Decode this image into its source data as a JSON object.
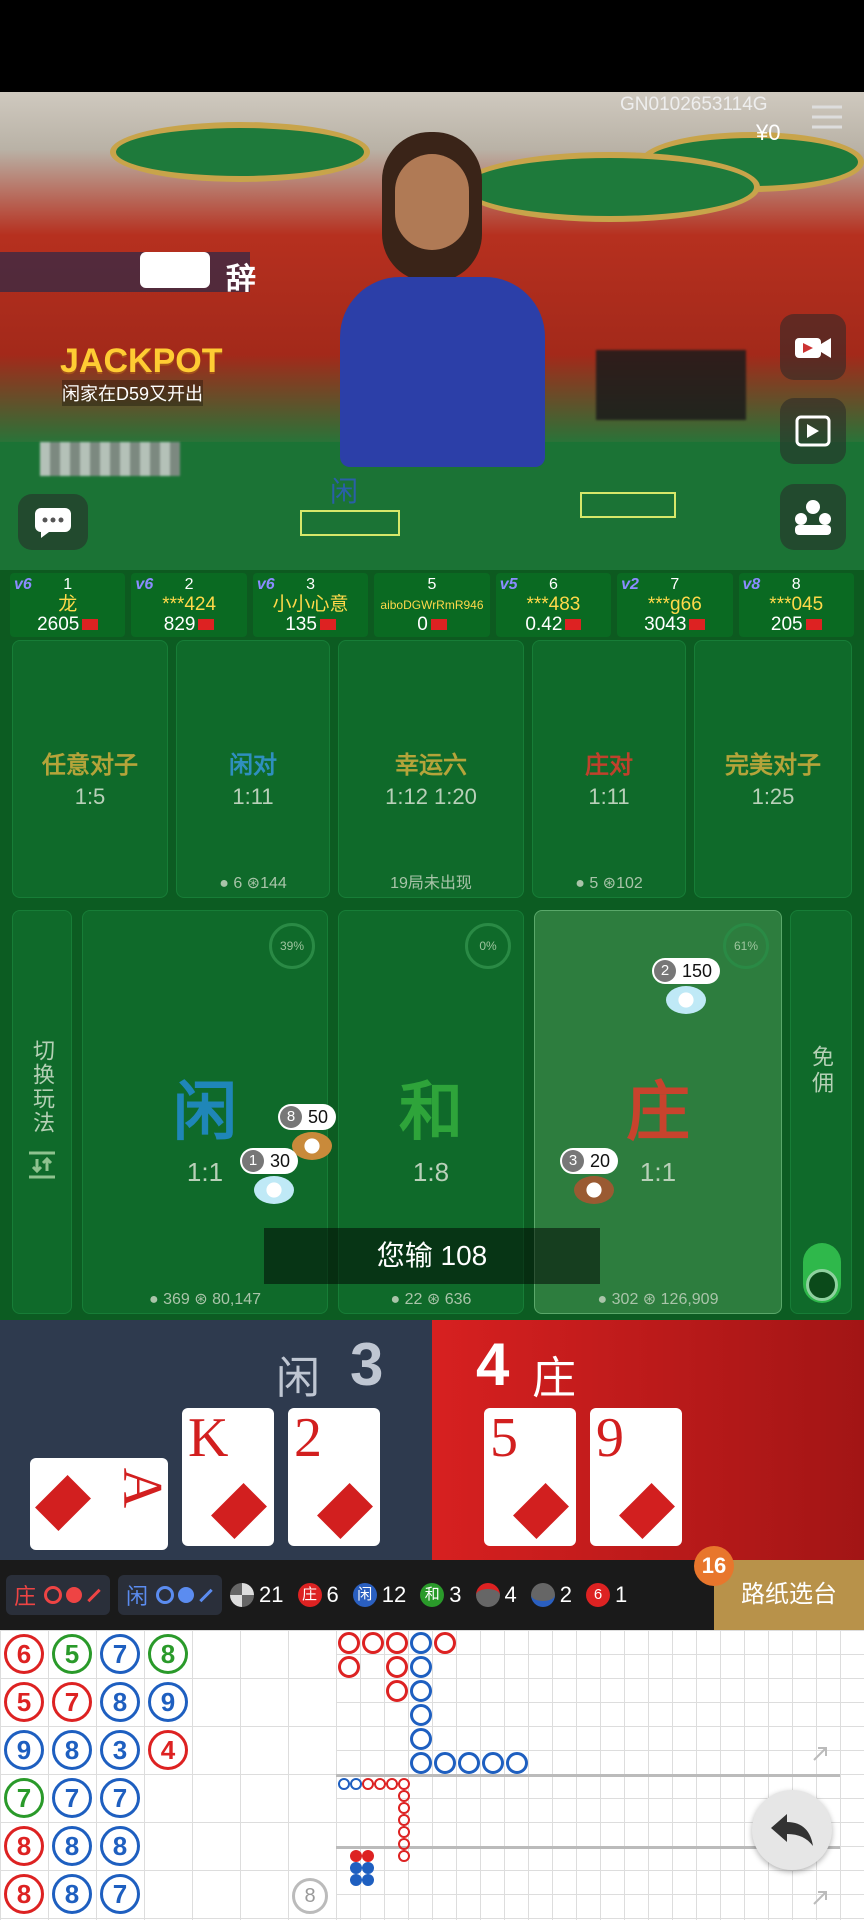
{
  "video": {
    "game_id": "GN0102653114G",
    "balance": "¥0",
    "jackpot_label": "JACKPOT",
    "jackpot_msg": "闲家在D59又开出",
    "announce_char": "辞",
    "hand_label": "闲"
  },
  "players": [
    {
      "level": "v6",
      "seat": "1",
      "name": "龙",
      "balance": "2605"
    },
    {
      "level": "v6",
      "seat": "2",
      "name": "***424",
      "balance": "829"
    },
    {
      "level": "v6",
      "seat": "3",
      "name": "小小心意",
      "balance": "135"
    },
    {
      "level": "",
      "seat": "5",
      "name": "aiboDGWrRmR946",
      "balance": "0"
    },
    {
      "level": "v5",
      "seat": "6",
      "name": "***483",
      "balance": "0.42"
    },
    {
      "level": "v2",
      "seat": "7",
      "name": "***g66",
      "balance": "3043"
    },
    {
      "level": "v8",
      "seat": "8",
      "name": "***045",
      "balance": "205"
    }
  ],
  "side_bets": [
    {
      "title": "任意对子",
      "odds": "1:5",
      "color": "#b5a43a",
      "users": "",
      "amount": ""
    },
    {
      "title": "闲对",
      "odds": "1:11",
      "color": "#2f8fbf",
      "users": "6",
      "amount": "144"
    },
    {
      "title": "幸运六",
      "odds": "1:12  1:20",
      "color": "#b5a43a",
      "users": "",
      "amount": "",
      "note": "19局未出现"
    },
    {
      "title": "庄对",
      "odds": "1:11",
      "color": "#c0412c",
      "users": "5",
      "amount": "102"
    },
    {
      "title": "完美对子",
      "odds": "1:25",
      "color": "#b5a43a",
      "users": "",
      "amount": ""
    }
  ],
  "main_bets": [
    {
      "title": "闲",
      "odds": "1:1",
      "color": "#1f86b8",
      "pct": "39%",
      "users": "369",
      "amount": "80,147"
    },
    {
      "title": "和",
      "odds": "1:8",
      "color": "#2ea43a",
      "pct": "0%",
      "users": "22",
      "amount": "636"
    },
    {
      "title": "庄",
      "odds": "1:1",
      "color": "#c8432d",
      "pct": "61%",
      "users": "302",
      "amount": "126,909"
    }
  ],
  "chips": [
    {
      "seat": "2",
      "amount": "150"
    },
    {
      "seat": "8",
      "amount": "50"
    },
    {
      "seat": "1",
      "amount": "30"
    },
    {
      "seat": "3",
      "amount": "20"
    }
  ],
  "switch_mode": "切换玩法",
  "commission_free": "免佣",
  "result_toast": "您输 108",
  "hand": {
    "player_label": "闲",
    "player_score": "3",
    "banker_label": "庄",
    "banker_score": "4",
    "player_cards": [
      "A",
      "K",
      "2"
    ],
    "banker_cards": [
      "5",
      "9"
    ]
  },
  "stats": {
    "banker_pill": "庄",
    "player_pill": "闲",
    "total": "21",
    "banker": "6",
    "player": "12",
    "tie": "3",
    "banker_pair": "4",
    "player_pair": "2",
    "six": "1",
    "six_label": "6",
    "banker_dot": "庄",
    "player_dot": "闲",
    "tie_dot": "和",
    "badge": "16",
    "road_select": "路纸选台"
  },
  "bead_road": [
    [
      {
        "n": "6",
        "c": "#d22"
      },
      {
        "n": "5",
        "c": "#2a9a2a"
      },
      {
        "n": "7",
        "c": "#1e5fc0"
      },
      {
        "n": "8",
        "c": "#2a9a2a"
      }
    ],
    [
      {
        "n": "5",
        "c": "#d22"
      },
      {
        "n": "7",
        "c": "#d22"
      },
      {
        "n": "8",
        "c": "#1e5fc0"
      },
      {
        "n": "9",
        "c": "#1e5fc0"
      }
    ],
    [
      {
        "n": "9",
        "c": "#1e5fc0"
      },
      {
        "n": "8",
        "c": "#1e5fc0"
      },
      {
        "n": "3",
        "c": "#1e5fc0"
      },
      {
        "n": "4",
        "c": "#d22"
      }
    ],
    [
      {
        "n": "7",
        "c": "#2a9a2a"
      },
      {
        "n": "7",
        "c": "#1e5fc0"
      },
      {
        "n": "7",
        "c": "#1e5fc0"
      }
    ],
    [
      {
        "n": "8",
        "c": "#d22"
      },
      {
        "n": "8",
        "c": "#1e5fc0"
      },
      {
        "n": "8",
        "c": "#1e5fc0"
      }
    ],
    [
      {
        "n": "8",
        "c": "#d22"
      },
      {
        "n": "8",
        "c": "#1e5fc0"
      },
      {
        "n": "7",
        "c": "#1e5fc0"
      }
    ]
  ],
  "shuffle_count": "8"
}
